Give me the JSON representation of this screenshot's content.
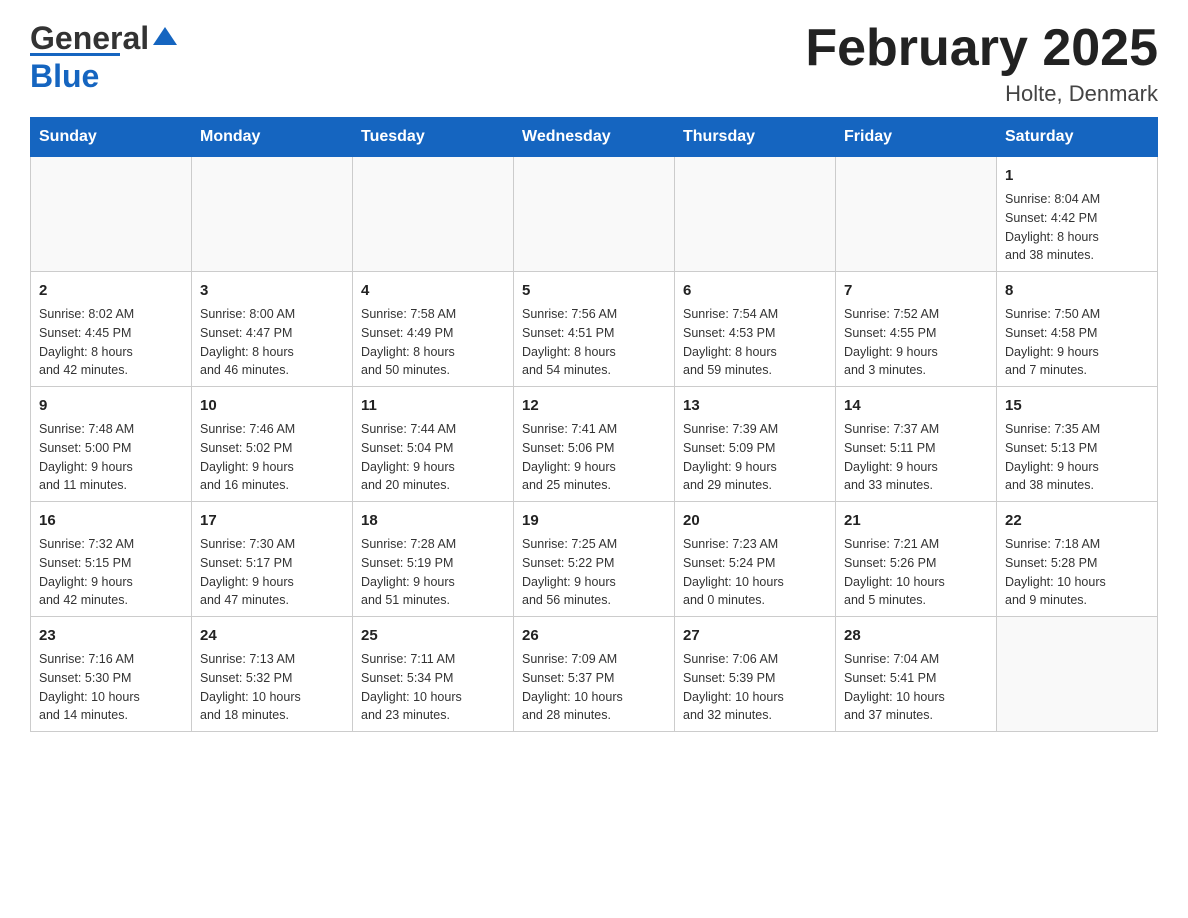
{
  "header": {
    "logo_general": "General",
    "logo_blue": "Blue",
    "month_title": "February 2025",
    "location": "Holte, Denmark"
  },
  "days_of_week": [
    "Sunday",
    "Monday",
    "Tuesday",
    "Wednesday",
    "Thursday",
    "Friday",
    "Saturday"
  ],
  "weeks": [
    [
      {
        "day": "",
        "info": ""
      },
      {
        "day": "",
        "info": ""
      },
      {
        "day": "",
        "info": ""
      },
      {
        "day": "",
        "info": ""
      },
      {
        "day": "",
        "info": ""
      },
      {
        "day": "",
        "info": ""
      },
      {
        "day": "1",
        "info": "Sunrise: 8:04 AM\nSunset: 4:42 PM\nDaylight: 8 hours\nand 38 minutes."
      }
    ],
    [
      {
        "day": "2",
        "info": "Sunrise: 8:02 AM\nSunset: 4:45 PM\nDaylight: 8 hours\nand 42 minutes."
      },
      {
        "day": "3",
        "info": "Sunrise: 8:00 AM\nSunset: 4:47 PM\nDaylight: 8 hours\nand 46 minutes."
      },
      {
        "day": "4",
        "info": "Sunrise: 7:58 AM\nSunset: 4:49 PM\nDaylight: 8 hours\nand 50 minutes."
      },
      {
        "day": "5",
        "info": "Sunrise: 7:56 AM\nSunset: 4:51 PM\nDaylight: 8 hours\nand 54 minutes."
      },
      {
        "day": "6",
        "info": "Sunrise: 7:54 AM\nSunset: 4:53 PM\nDaylight: 8 hours\nand 59 minutes."
      },
      {
        "day": "7",
        "info": "Sunrise: 7:52 AM\nSunset: 4:55 PM\nDaylight: 9 hours\nand 3 minutes."
      },
      {
        "day": "8",
        "info": "Sunrise: 7:50 AM\nSunset: 4:58 PM\nDaylight: 9 hours\nand 7 minutes."
      }
    ],
    [
      {
        "day": "9",
        "info": "Sunrise: 7:48 AM\nSunset: 5:00 PM\nDaylight: 9 hours\nand 11 minutes."
      },
      {
        "day": "10",
        "info": "Sunrise: 7:46 AM\nSunset: 5:02 PM\nDaylight: 9 hours\nand 16 minutes."
      },
      {
        "day": "11",
        "info": "Sunrise: 7:44 AM\nSunset: 5:04 PM\nDaylight: 9 hours\nand 20 minutes."
      },
      {
        "day": "12",
        "info": "Sunrise: 7:41 AM\nSunset: 5:06 PM\nDaylight: 9 hours\nand 25 minutes."
      },
      {
        "day": "13",
        "info": "Sunrise: 7:39 AM\nSunset: 5:09 PM\nDaylight: 9 hours\nand 29 minutes."
      },
      {
        "day": "14",
        "info": "Sunrise: 7:37 AM\nSunset: 5:11 PM\nDaylight: 9 hours\nand 33 minutes."
      },
      {
        "day": "15",
        "info": "Sunrise: 7:35 AM\nSunset: 5:13 PM\nDaylight: 9 hours\nand 38 minutes."
      }
    ],
    [
      {
        "day": "16",
        "info": "Sunrise: 7:32 AM\nSunset: 5:15 PM\nDaylight: 9 hours\nand 42 minutes."
      },
      {
        "day": "17",
        "info": "Sunrise: 7:30 AM\nSunset: 5:17 PM\nDaylight: 9 hours\nand 47 minutes."
      },
      {
        "day": "18",
        "info": "Sunrise: 7:28 AM\nSunset: 5:19 PM\nDaylight: 9 hours\nand 51 minutes."
      },
      {
        "day": "19",
        "info": "Sunrise: 7:25 AM\nSunset: 5:22 PM\nDaylight: 9 hours\nand 56 minutes."
      },
      {
        "day": "20",
        "info": "Sunrise: 7:23 AM\nSunset: 5:24 PM\nDaylight: 10 hours\nand 0 minutes."
      },
      {
        "day": "21",
        "info": "Sunrise: 7:21 AM\nSunset: 5:26 PM\nDaylight: 10 hours\nand 5 minutes."
      },
      {
        "day": "22",
        "info": "Sunrise: 7:18 AM\nSunset: 5:28 PM\nDaylight: 10 hours\nand 9 minutes."
      }
    ],
    [
      {
        "day": "23",
        "info": "Sunrise: 7:16 AM\nSunset: 5:30 PM\nDaylight: 10 hours\nand 14 minutes."
      },
      {
        "day": "24",
        "info": "Sunrise: 7:13 AM\nSunset: 5:32 PM\nDaylight: 10 hours\nand 18 minutes."
      },
      {
        "day": "25",
        "info": "Sunrise: 7:11 AM\nSunset: 5:34 PM\nDaylight: 10 hours\nand 23 minutes."
      },
      {
        "day": "26",
        "info": "Sunrise: 7:09 AM\nSunset: 5:37 PM\nDaylight: 10 hours\nand 28 minutes."
      },
      {
        "day": "27",
        "info": "Sunrise: 7:06 AM\nSunset: 5:39 PM\nDaylight: 10 hours\nand 32 minutes."
      },
      {
        "day": "28",
        "info": "Sunrise: 7:04 AM\nSunset: 5:41 PM\nDaylight: 10 hours\nand 37 minutes."
      },
      {
        "day": "",
        "info": ""
      }
    ]
  ]
}
